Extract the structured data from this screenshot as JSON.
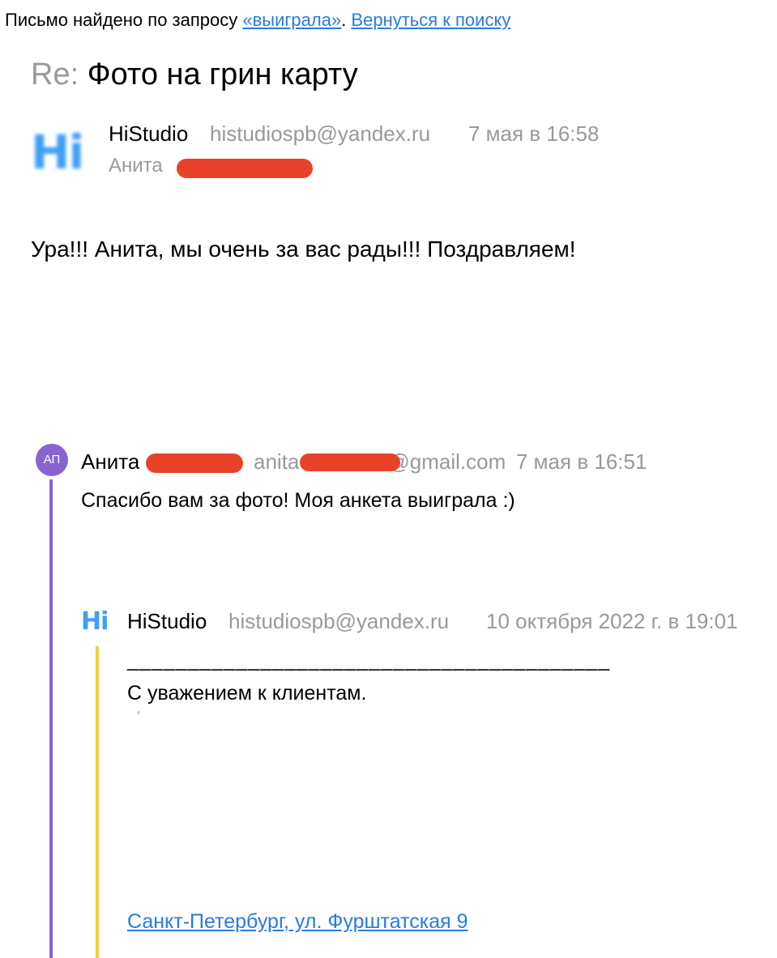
{
  "search_bar": {
    "prefix": "Письмо найдено по запросу ",
    "query_link": "«выиграла»",
    "separator": ". ",
    "back_link": "Вернуться к поиску"
  },
  "email": {
    "subject_prefix": "Re:",
    "subject": "Фото на грин карту",
    "sender_avatar": "Hi",
    "sender_name": "HiStudio",
    "sender_email": "histudiospb@yandex.ru",
    "date": "7 мая в 16:58",
    "recipient": "Анита",
    "body": "Ура!!! Анита, мы очень за вас рады!!! Поздравляем!"
  },
  "quoted_1": {
    "avatar_initials": "АП",
    "sender_name": "Анита",
    "sender_email_visible": "anita",
    "sender_email_suffix": "@gmail.com",
    "date": "7 мая в 16:51",
    "body": "Спасибо вам  за фото! Моя анкета выиграла :)"
  },
  "quoted_2": {
    "avatar": "Hi",
    "sender_name": "HiStudio",
    "sender_email": "histudiospb@yandex.ru",
    "date": "10 октября 2022 г. в 19:01",
    "divider": "________________________________________",
    "signature": "С уважением к клиентам.",
    "address_link": "Санкт-Петербург, ул. Фурштатская 9"
  },
  "colors": {
    "link": "#2a7ae2",
    "muted": "#999999",
    "redaction": "#e8432a",
    "quote_bar_1": "#8a63d2",
    "quote_bar_2": "#f2cf4a",
    "brand_hi": "#3da0f5"
  }
}
